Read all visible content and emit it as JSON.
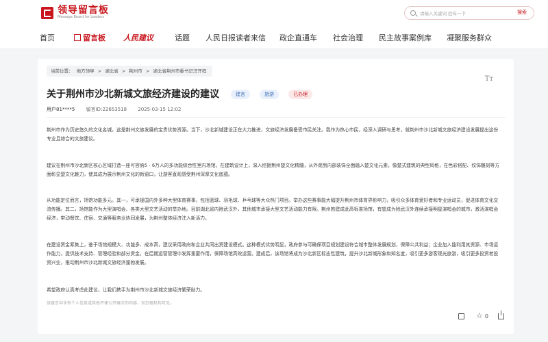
{
  "header": {
    "logo_cn": "领导留言板",
    "logo_en": "Message Board for Leaders",
    "search_placeholder": "请输入关键词 回车一下",
    "search_button": "搜索"
  },
  "nav": {
    "items": [
      "首页",
      "留言板",
      "人民建议",
      "话题",
      "人民日报读者来信",
      "政企直通车",
      "社会治理",
      "民主故事案例库",
      "凝聚服务群众"
    ]
  },
  "article": {
    "breadcrumb": [
      "当前位置：",
      "地方领导",
      ">",
      "湖北省",
      ">",
      "荆州市",
      ">",
      "湖北省荆州市委书记汪开程"
    ],
    "font_size_icon": "Tт",
    "title": "关于荆州市沙北新城文旅经济建设的建议",
    "tags": [
      "建言",
      "旅游",
      "已办理"
    ],
    "user": "用户81****5",
    "message_id": "留言ID:22653518",
    "date": "2025-03-15 12:02",
    "paragraphs": [
      "荆州市作为历史悠久的文化名城，这是荆州文旅发展的宝贵优势资源。当下，沙北新城建设正在大力推进，文旅经济发展备受市民关注。我作为热心市民，经深入调研与思考，就荆州市沙北新城文旅经济建设发展提出这份专业且综合的文旅建议。",
      "建议在荆州市沙北新区核心区域打造一座可容纳5 - 6万人的多功能综合性室内场馆。在建筑设计上，深入挖掘荆州楚文化精髓，从外观到内部装饰全面融入楚文化元素，像楚式建筑的典型风格，在色彩搭配、纹饰雕刻等方面彰显楚文化魅力，使其成为展示荆州文化的新窗口，让游客直观感受荆州深厚文化底蕴。",
      "从功能定位而言，场馆功能多元。其一，可承接国内外多种大型体育赛事，包括篮球、羽毛球、乒乓球等大众热门项目。举办这些赛事能大幅提升荆州市体育界影响力，吸引众多体育爱好者和专业运动员，促进体育文化交流传播。其二，场馆能作为大型演唱会、各类大型文艺活动的举办地。目前湖北省内除武汉外，其他城市承接大型文艺活动能力有限。荆州若建成此高标准场馆，有望成为除武汉外连续承接明星演唱会的城市，激活演唱会经济，带动餐饮、住宿、交通等服务业协同发展，为荆州整体经济注入新活力。",
      "在建设资金筹集上，鉴于场馆规模大、功能多、成本高，建议采用政府和企业共同出资建设模式。这种模式优势明显，政府参与可确保项目规划建设符合城市整体发展规划，保障公共利益；企业加入能利用其资源、市场运作能力，提供技术支持、管理经验和部分资金，在后期运营管理中发挥重要作用，保障场馆高效运营。建成后，该场馆将成为沙北新区标志性建筑，提升沙北新城形象和知名度，吸引更多游客观光旅游，吸引更多投资者投资兴业，推动荆州市沙北新城文旅经济蓬勃发展。",
      "希望政府认真考虑此建议，让我们携手为荆州市沙北新城文旅经济繁荣助力。"
    ],
    "notice": "该留言中含有个人信息或其他不便公开展示的内容，仅办理机构可见。",
    "likes": "",
    "stars": "0"
  }
}
